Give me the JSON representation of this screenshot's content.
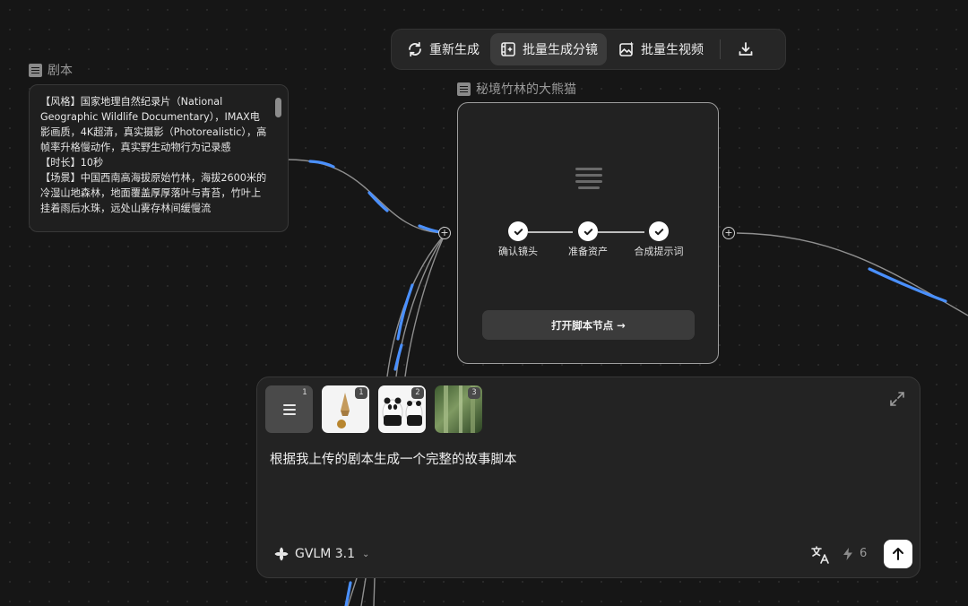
{
  "toolbar": {
    "regenerate_label": "重新生成",
    "batch_storyboard_label": "批量生成分镜",
    "batch_video_label": "批量生视频"
  },
  "script_node": {
    "label": "剧本",
    "content": "【风格】国家地理自然纪录片（National Geographic Wildlife Documentary），IMAX电影画质，4K超清，真实摄影（Photorealistic），高帧率升格慢动作，真实野生动物行为记录感\n【时长】10秒\n【场景】中国西南高海拔原始竹林，海拔2600米的冷湿山地森林，地面覆盖厚厚落叶与青苔，竹叶上挂着雨后水珠，远处山雾存林间缓慢流"
  },
  "story_node": {
    "label": "秘境竹林的大熊猫",
    "steps": [
      {
        "label": "确认镜头"
      },
      {
        "label": "准备资产"
      },
      {
        "label": "合成提示词"
      }
    ],
    "open_button": "打开脚本节点 →"
  },
  "prompt_panel": {
    "attachments": [
      {
        "kind": "document",
        "badge": "1"
      },
      {
        "kind": "image-cone",
        "badge": "1"
      },
      {
        "kind": "image-panda",
        "badge": "2"
      },
      {
        "kind": "image-bamboo",
        "badge": "3"
      }
    ],
    "prompt_text": "根据我上传的剧本生成一个完整的故事脚本",
    "model_name": "GVLM 3.1",
    "credits": "6"
  },
  "colors": {
    "background": "#161616",
    "accent_wire": "#4a90ff",
    "node_border": "#9e9e9e"
  }
}
